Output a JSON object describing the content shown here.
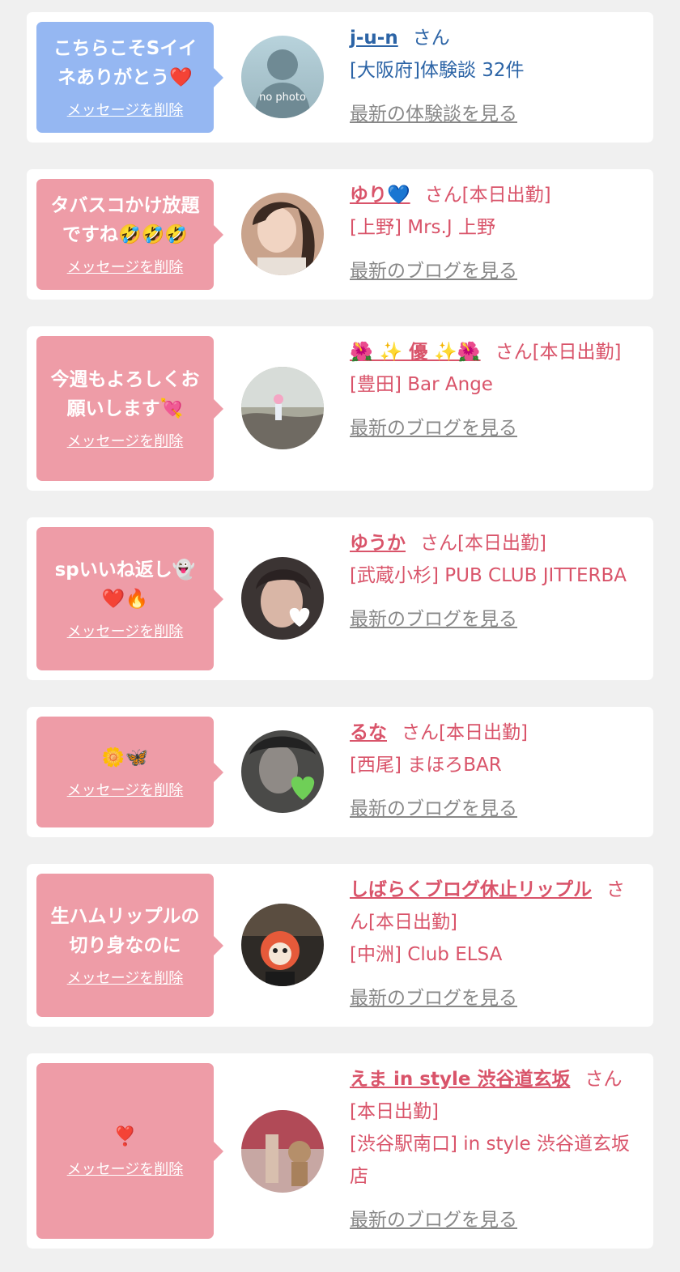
{
  "suffix_san": "さん",
  "delete_label": "メッセージを削除",
  "colors": {
    "bubble_blue": "#95b7f2",
    "bubble_pink": "#ee9ca7",
    "name_pink": "#d9546a",
    "name_blue": "#2c64a6",
    "link_gray": "#888888"
  },
  "items": [
    {
      "message": "こちらこそSイイ\nネありがとう❤️",
      "name": "j-u-n",
      "status": "",
      "detail": "[大阪府]体験談 32件",
      "link": "最新の体験談を見る",
      "avatar_text": "no photo"
    },
    {
      "message": "タバスコかけ放題\nですね🤣🤣🤣",
      "name": "ゆり💙",
      "status": "[本日出勤]",
      "detail": "[上野] Mrs.J 上野",
      "link": "最新のブログを見る"
    },
    {
      "message": "今週もよろしくお\n願いします💘",
      "name": "🌺 ✨ 優 ✨🌺",
      "status": "[本日出勤]",
      "detail": "[豊田] Bar Ange",
      "link": "最新のブログを見る"
    },
    {
      "message": "spいいね返し👻\n❤️🔥",
      "name": "ゆうか",
      "status": "[本日出勤]",
      "detail": "[武蔵小杉] PUB CLUB JITTERBA",
      "link": "最新のブログを見る"
    },
    {
      "message": "🌼🦋",
      "name": "るな",
      "status": "[本日出勤]",
      "detail": "[西尾] まほろBAR",
      "link": "最新のブログを見る"
    },
    {
      "message": "生ハムリップルの\n切り身なのに",
      "name": "しばらくブログ休止リップル",
      "status": "[本日出勤]",
      "detail": "[中洲] Club ELSA",
      "link": "最新のブログを見る"
    },
    {
      "message": "❣️",
      "name": "えま in style 渋谷道玄坂",
      "status": "[本日出勤]",
      "detail": "[渋谷駅南口] in style 渋谷道玄坂店",
      "link": "最新のブログを見る"
    }
  ]
}
